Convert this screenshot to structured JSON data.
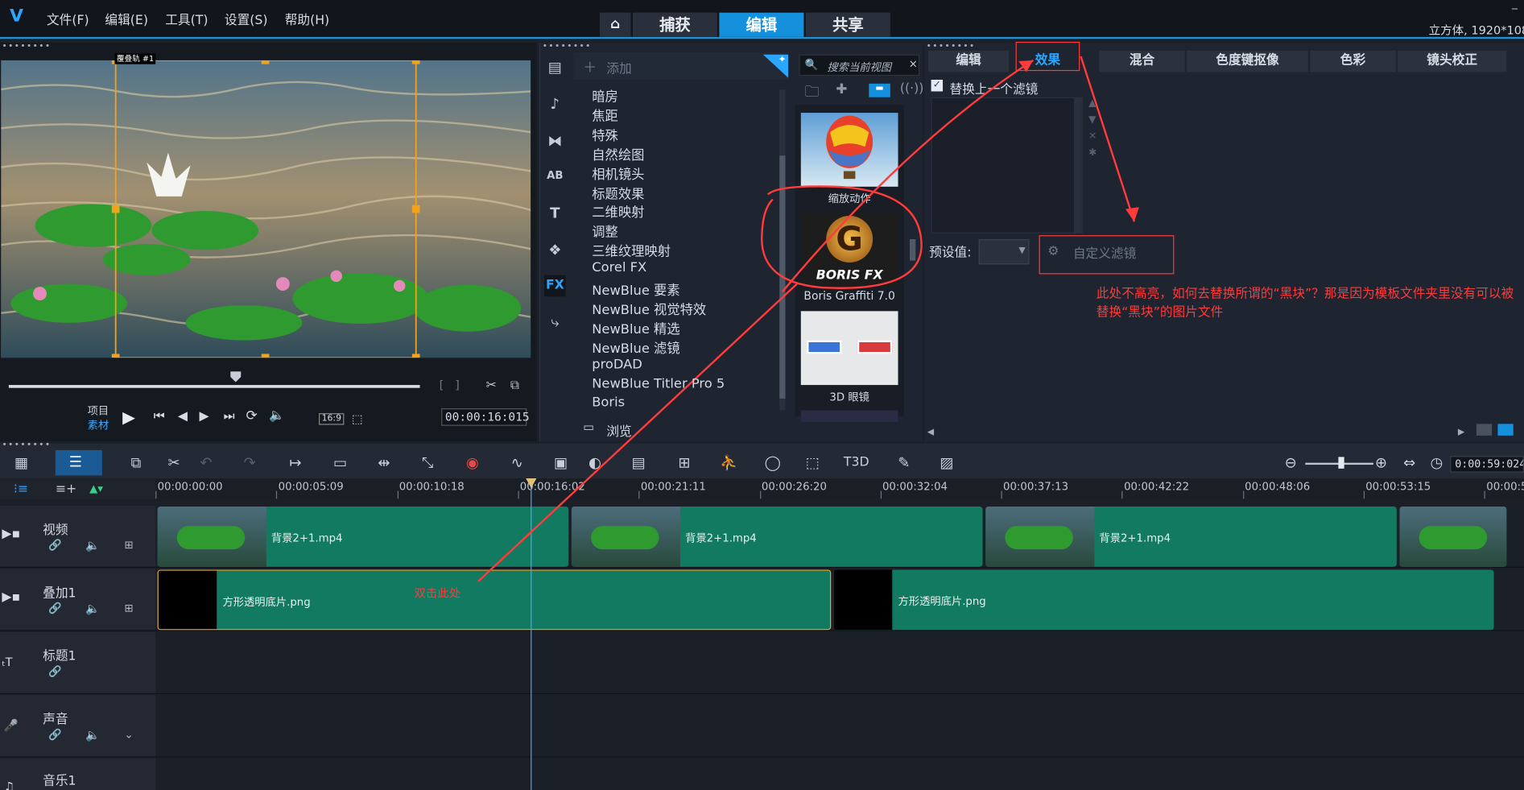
{
  "menu": {
    "items": [
      "文件(F)",
      "编辑(E)",
      "工具(T)",
      "设置(S)",
      "帮助(H)"
    ]
  },
  "main_tabs": {
    "home_icon": "home-icon",
    "capture": "捕获",
    "edit": "编辑",
    "share": "共享"
  },
  "project_info": "立方体, 1920*108",
  "preview": {
    "overlay_label": "覆叠轨 #1",
    "project_label": "项目",
    "clip_label": "素材",
    "aspect": "16:9",
    "timecode": "00:00:16:015"
  },
  "library": {
    "add_label": "添加",
    "search_placeholder": "搜索当前视图",
    "categories": [
      "暗房",
      "焦距",
      "特殊",
      "自然绘图",
      "相机镜头",
      "标题效果",
      "二维映射",
      "调整",
      "三维纹理映射",
      "Corel FX",
      "NewBlue 要素",
      "NewBlue 视觉特效",
      "NewBlue 精选",
      "NewBlue 滤镜",
      "proDAD",
      "NewBlue Titler Pro 5",
      "Boris"
    ],
    "browse_label": "浏览",
    "thumbnails": [
      {
        "label": "缩放动作"
      },
      {
        "label": "Boris Graffiti 7.0",
        "logo_text": "BORIS FX"
      },
      {
        "label": "3D 眼镜"
      }
    ]
  },
  "options": {
    "tabs": [
      "编辑",
      "效果",
      "混合",
      "色度键抠像",
      "色彩",
      "镜头校正"
    ],
    "replace_checkbox": "替换上一个滤镜",
    "preset_label": "预设值:",
    "custom_filter_label": "自定义滤镜",
    "annotation": "此处不高亮，如何去替换所谓的“黑块”？那是因为模板文件夹里没有可以被替换“黑块”的图片文件"
  },
  "timeline": {
    "zoom_time": "0:00:59:024",
    "ruler_ticks": [
      "00:00:00:00",
      "00:00:05:09",
      "00:00:10:18",
      "00:00:16:02",
      "00:00:21:11",
      "00:00:26:20",
      "00:00:32:04",
      "00:00:37:13",
      "00:00:42:22",
      "00:00:48:06",
      "00:00:53:15",
      "00:00:5"
    ],
    "tracks": [
      {
        "name": "视频",
        "clips": [
          "背景2+1.mp4",
          "背景2+1.mp4",
          "背景2+1.mp4"
        ]
      },
      {
        "name": "叠加1",
        "clips": [
          "方形透明底片.png",
          "方形透明底片.png"
        ]
      },
      {
        "name": "标题1",
        "clips": []
      },
      {
        "name": "声音",
        "clips": []
      },
      {
        "name": "音乐1",
        "clips": []
      }
    ],
    "annotation": "双击此处"
  }
}
